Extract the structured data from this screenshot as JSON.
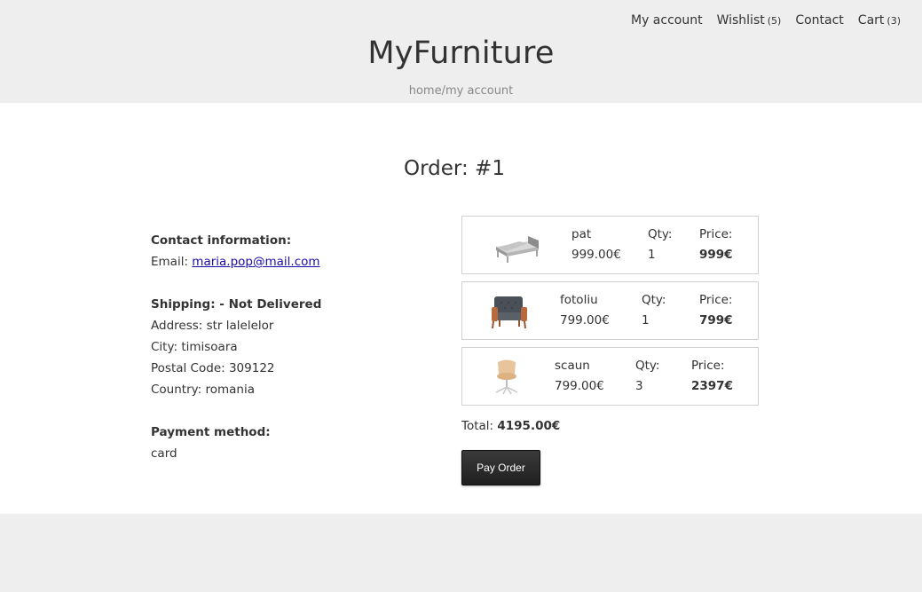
{
  "nav": {
    "my_account": "My account",
    "wishlist": "Wishlist",
    "wishlist_count": "(5)",
    "contact": "Contact",
    "cart": "Cart",
    "cart_count": "(3)"
  },
  "brand": "MyFurniture",
  "breadcrumb": {
    "home": "home",
    "sep": "/",
    "current": "my account"
  },
  "order": {
    "title": "Order: #1",
    "contact_heading": "Contact information:",
    "email_label": "Email: ",
    "email": "maria.pop@mail.com",
    "shipping_heading": "Shipping: -  Not Delivered",
    "address": "Address: str lalelelor",
    "city": "City: timisoara",
    "postal": "Postal Code: 309122",
    "country": "Country: romania",
    "payment_heading": "Payment method:",
    "payment_method": "card",
    "items": [
      {
        "name": "pat",
        "unit_price": "999.00€",
        "qty_label": "Qty:",
        "qty": "1",
        "price_label": "Price:",
        "price": "999€",
        "icon": "bed-icon"
      },
      {
        "name": "fotoliu",
        "unit_price": "799.00€",
        "qty_label": "Qty:",
        "qty": "1",
        "price_label": "Price:",
        "price": "799€",
        "icon": "armchair-icon"
      },
      {
        "name": "scaun",
        "unit_price": "799.00€",
        "qty_label": "Qty:",
        "qty": "3",
        "price_label": "Price:",
        "price": "2397€",
        "icon": "chair-icon"
      }
    ],
    "total_label": "Total: ",
    "total": "4195.00€",
    "pay_button": "Pay Order"
  }
}
